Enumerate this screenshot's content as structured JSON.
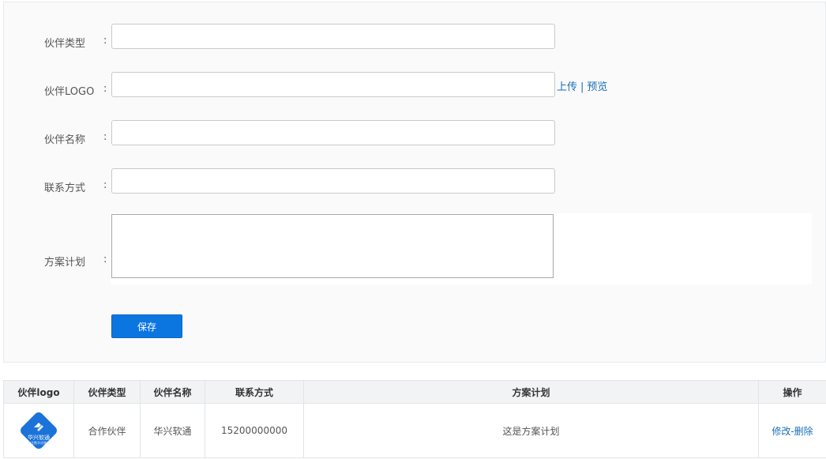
{
  "form": {
    "partner_type": {
      "label": "伙伴类型",
      "colon": ":",
      "value": "",
      "placeholder": ""
    },
    "partner_logo": {
      "label": "伙伴LOGO",
      "colon": ":",
      "value": "",
      "placeholder": ""
    },
    "upload": {
      "upload_label": "上传",
      "separator": "|",
      "preview_label": "预览"
    },
    "partner_name": {
      "label": "伙伴名称",
      "colon": ":",
      "value": "",
      "placeholder": ""
    },
    "contact": {
      "label": "联系方式",
      "colon": ":",
      "value": "",
      "placeholder": ""
    },
    "plan": {
      "label": "方案计划",
      "colon": ":",
      "value": ""
    },
    "save_label": "保存"
  },
  "table": {
    "headers": [
      "伙伴logo",
      "伙伴类型",
      "伙伴名称",
      "联系方式",
      "方案计划",
      "操作"
    ],
    "rows": [
      {
        "logo": {
          "name": "华兴软通",
          "tagline": "专注数字化服务",
          "icon": "huaxing-logo"
        },
        "type": "合作伙伴",
        "name": "华兴软通",
        "contact": "15200000000",
        "plan": "这是方案计划",
        "actions": {
          "edit": "修改",
          "separator": "-",
          "delete": "删除"
        }
      }
    ]
  },
  "colors": {
    "accent": "#0b76e0",
    "link": "#1a6fb5",
    "logo_blue": "#1b73d9",
    "panel_bg": "#fafafb",
    "header_bg": "#f2f3f5"
  }
}
